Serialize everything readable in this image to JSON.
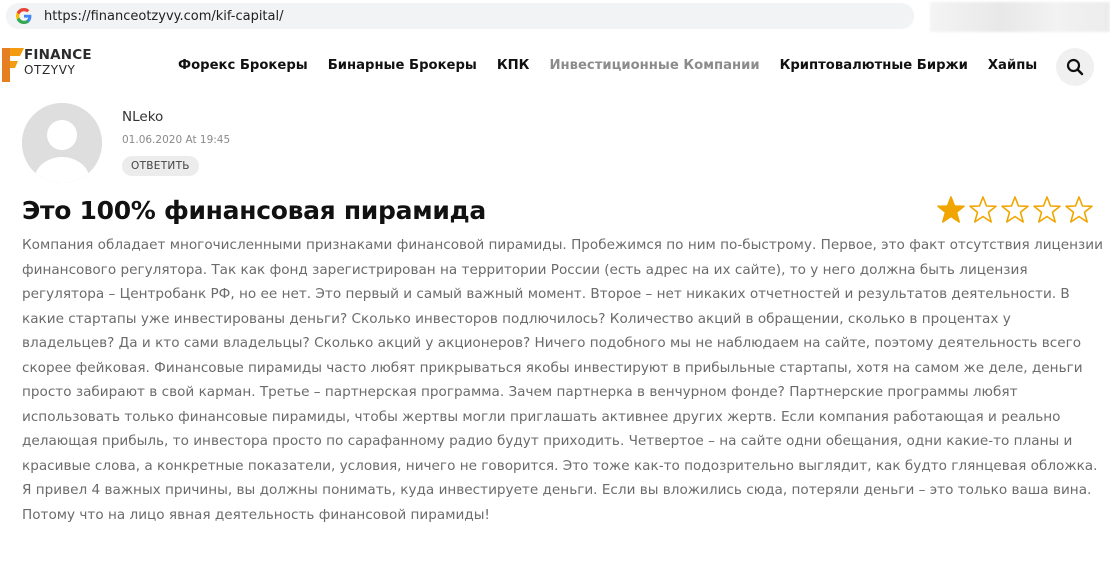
{
  "browser": {
    "url": "https://financeotzyvy.com/kif-capital/"
  },
  "header": {
    "logo_word1": "FINANCE",
    "logo_word2": "OTZYVY",
    "nav": [
      {
        "label": "Форекс Брокеры",
        "active": false
      },
      {
        "label": "Бинарные Брокеры",
        "active": false
      },
      {
        "label": "КПК",
        "active": false
      },
      {
        "label": "Инвестиционные Компании",
        "active": true
      },
      {
        "label": "Криптовалютные Биржи",
        "active": false
      },
      {
        "label": "Хайпы",
        "active": false
      }
    ]
  },
  "review": {
    "author": "NLeko",
    "date": "01.06.2020 At 19:45",
    "reply_label": "ОТВЕТИТЬ",
    "title": "Это 100% финансовая пирамида",
    "rating": 1,
    "rating_max": 5,
    "paragraph1": "Компания обладает многочисленными признаками финансовой пирамиды. Пробежимся по ним по-быстрому. Первое, это факт отсутствия лицензии финансового регулятора. Так как фонд зарегистрирован на территории России (есть адрес на их сайте), то у него должна быть лицензия регулятора – Центробанк РФ, но ее нет. Это первый и самый важный момент. Второе – нет никаких отчетностей и результатов деятельности. В какие стартапы уже инвестированы деньги? Сколько инвесторов подлючилось? Количество акций в обращении, сколько в процентах у владельцев? Да и кто сами владельцы? Сколько акций у акционеров? Ничего подобного мы не наблюдаем на сайте, поэтому деятельность всего скорее фейковая. Финансовые пирамиды часто любят прикрываться якобы инвестируют в прибыльные стартапы, хотя на самом же деле, деньги просто забирают в свой карман. Третье – партнерская программа. Зачем партнерка в венчурном фонде? Партнерские программы любят использовать только финансовые пирамиды, чтобы жертвы могли приглашать активнее других жертв. Если компания работающая и реально делающая прибыль, то инвестора просто по сарафанному радио будут приходить. Четвертое – на сайте одни обещания, одни какие-то планы и красивые слова, а конкретные показатели, условия, ничего не говорится. Это тоже как-то подозрительно выглядит, как будто глянцевая обложка.",
    "paragraph2": "Я привел 4 важных причины, вы должны понимать, куда инвестируете деньги. Если вы вложились сюда, потеряли деньги – это только ваша вина. Потому что на лицо явная деятельность финансовой пирамиды!"
  },
  "colors": {
    "star_filled": "#f0a500",
    "star_outline": "#f0a500",
    "logo_orange": "#f39c12",
    "nav_active": "#8c8c8c"
  }
}
